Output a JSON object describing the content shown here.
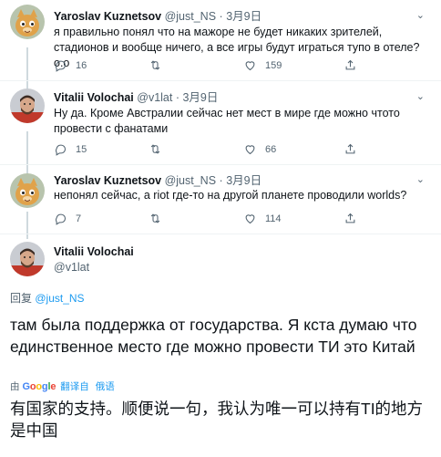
{
  "tweets": [
    {
      "name": "Yaroslav Kuznetsov",
      "handle": "@just_NS",
      "sep": "·",
      "date": "3月9日",
      "text": "я правильно понял что на мажоре не будет никаких зрителей, стадионов и вообще ничего, а все игры будут играться тупо в отеле? о.о",
      "replies": "16",
      "retweets": "",
      "likes": "159",
      "avatar": "cartoon-cat-avatar"
    },
    {
      "name": "Vitalii Volochai",
      "handle": "@v1lat",
      "sep": "·",
      "date": "3月9日",
      "text": "Ну да. Кроме Австралии сейчас нет мест в мире где можно чтото провести с фанатами",
      "replies": "15",
      "retweets": "",
      "likes": "66",
      "avatar": "man-photo-avatar"
    },
    {
      "name": "Yaroslav Kuznetsov",
      "handle": "@just_NS",
      "sep": "·",
      "date": "3月9日",
      "text": "непонял сейчас, а riot где-то на другой планете проводили worlds?",
      "replies": "7",
      "retweets": "",
      "likes": "114",
      "avatar": "cartoon-cat-avatar"
    }
  ],
  "main": {
    "name": "Vitalii Volochai",
    "handle": "@v1lat",
    "replying_prefix": "回复",
    "replying_to": "@just_NS",
    "text": "там была поддержка от государства. Я кста думаю что единственное место где можно провести ТИ это Китай",
    "translate_by": "由",
    "translate_service": "Google",
    "translate_label": "翻译自",
    "translate_lang": "俄语",
    "translated_text": "有国家的支持。顺便说一句，我认为唯一可以持有TI的地方是中国"
  },
  "icons": {
    "reply": "reply-icon",
    "retweet": "retweet-icon",
    "like": "heart-icon",
    "share": "share-icon",
    "more": "chevron-down-icon"
  },
  "colors": {
    "link": "#1d9bf0",
    "secondary_text": "#536471",
    "thread_line": "#cfd9de"
  }
}
